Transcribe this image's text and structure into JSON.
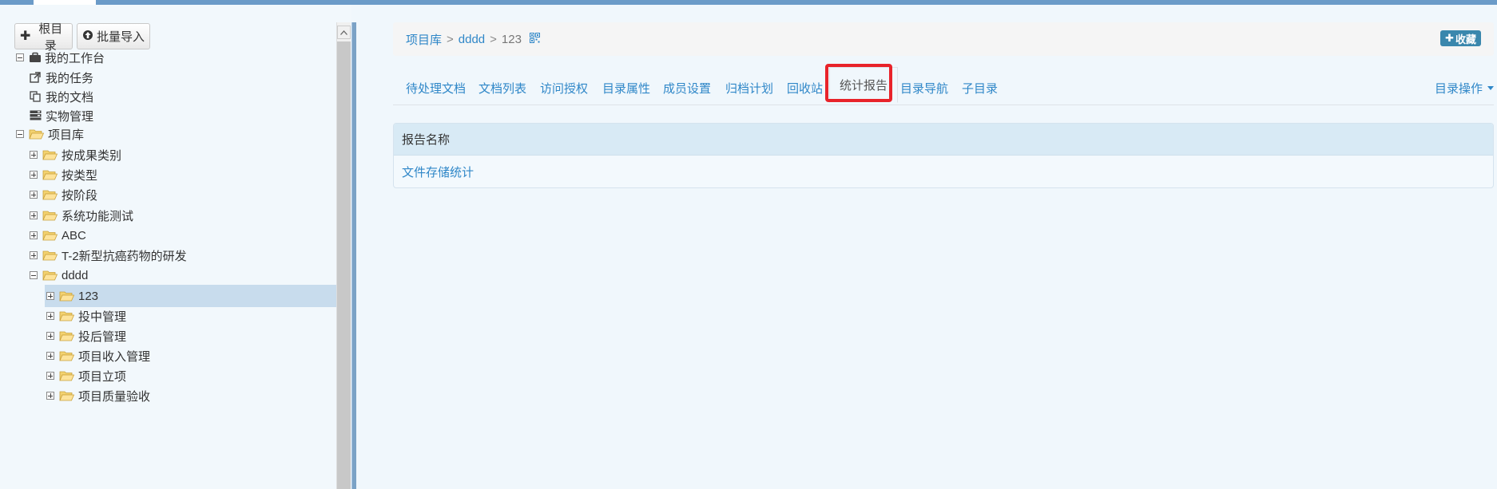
{
  "toolbar": {
    "root_button": "根目录",
    "import_button": "批量导入"
  },
  "tree": {
    "workbench": "我的工作台",
    "tasks": "我的任务",
    "documents": "我的文档",
    "physical": "实物管理",
    "project_lib": "项目库",
    "by_result_type": "按成果类别",
    "by_type": "按类型",
    "by_stage": "按阶段",
    "sys_test": "系统功能测试",
    "abc": "ABC",
    "t2": "T-2新型抗癌药物的研发",
    "dddd": "dddd",
    "n123": "123",
    "in_invest": "投中管理",
    "post_invest": "投后管理",
    "income": "项目收入管理",
    "setup": "项目立项",
    "quality": "项目质量验收"
  },
  "breadcrumb": {
    "level1": "项目库",
    "level2": "dddd",
    "current": "123",
    "fav_button": "收藏"
  },
  "tabs": [
    "待处理文档",
    "文档列表",
    "访问授权",
    "目录属性",
    "成员设置",
    "归档计划",
    "回收站",
    "统计报告",
    "目录导航",
    "子目录"
  ],
  "tab_ops": "目录操作",
  "active_tab": "统计报告",
  "report_table": {
    "header": "报告名称",
    "rows": [
      "文件存储统计"
    ]
  },
  "colors": {
    "link": "#2f87c8",
    "highlight": "#e8232a",
    "selected_row": "#c8dced"
  }
}
